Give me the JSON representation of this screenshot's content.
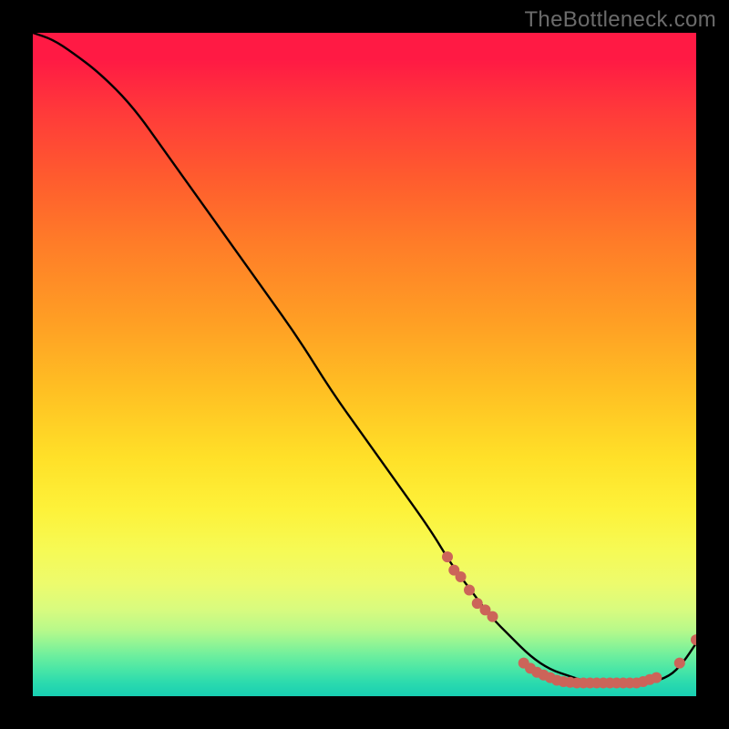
{
  "watermark": "TheBottleneck.com",
  "colors": {
    "background": "#000000",
    "curve": "#000000",
    "dot": "#cc6459"
  },
  "chart_data": {
    "type": "line",
    "title": "",
    "xlabel": "",
    "ylabel": "",
    "xlim": [
      0,
      100
    ],
    "ylim": [
      0,
      100
    ],
    "grid": false,
    "legend": false,
    "series": [
      {
        "name": "bottleneck-curve",
        "x": [
          0,
          3,
          6,
          10,
          15,
          20,
          25,
          30,
          35,
          40,
          45,
          50,
          55,
          60,
          63,
          66,
          69,
          72,
          75,
          78,
          81,
          84,
          87,
          90,
          93,
          96,
          98,
          100
        ],
        "y": [
          100,
          99,
          97,
          94,
          89,
          82,
          75,
          68,
          61,
          54,
          46,
          39,
          32,
          25,
          20,
          16,
          12,
          9,
          6,
          4,
          3,
          2,
          2,
          2,
          2,
          3,
          5,
          8
        ]
      }
    ],
    "markers": [
      {
        "x": 62.5,
        "y": 21
      },
      {
        "x": 63.5,
        "y": 19
      },
      {
        "x": 64.5,
        "y": 18
      },
      {
        "x": 65.8,
        "y": 16
      },
      {
        "x": 67.0,
        "y": 14
      },
      {
        "x": 68.2,
        "y": 13
      },
      {
        "x": 69.3,
        "y": 12
      },
      {
        "x": 74.0,
        "y": 5.0
      },
      {
        "x": 75.0,
        "y": 4.2
      },
      {
        "x": 76.0,
        "y": 3.6
      },
      {
        "x": 77.0,
        "y": 3.2
      },
      {
        "x": 78.0,
        "y": 2.8
      },
      {
        "x": 79.0,
        "y": 2.4
      },
      {
        "x": 80.0,
        "y": 2.2
      },
      {
        "x": 81.0,
        "y": 2.1
      },
      {
        "x": 82.0,
        "y": 2.0
      },
      {
        "x": 83.0,
        "y": 2.0
      },
      {
        "x": 84.0,
        "y": 2.0
      },
      {
        "x": 85.0,
        "y": 2.0
      },
      {
        "x": 86.0,
        "y": 2.0
      },
      {
        "x": 87.0,
        "y": 2.0
      },
      {
        "x": 88.0,
        "y": 2.0
      },
      {
        "x": 89.0,
        "y": 2.0
      },
      {
        "x": 90.0,
        "y": 2.0
      },
      {
        "x": 91.0,
        "y": 2.0
      },
      {
        "x": 92.0,
        "y": 2.2
      },
      {
        "x": 93.0,
        "y": 2.5
      },
      {
        "x": 94.0,
        "y": 2.8
      },
      {
        "x": 97.5,
        "y": 5.0
      },
      {
        "x": 100.0,
        "y": 8.5
      }
    ]
  }
}
